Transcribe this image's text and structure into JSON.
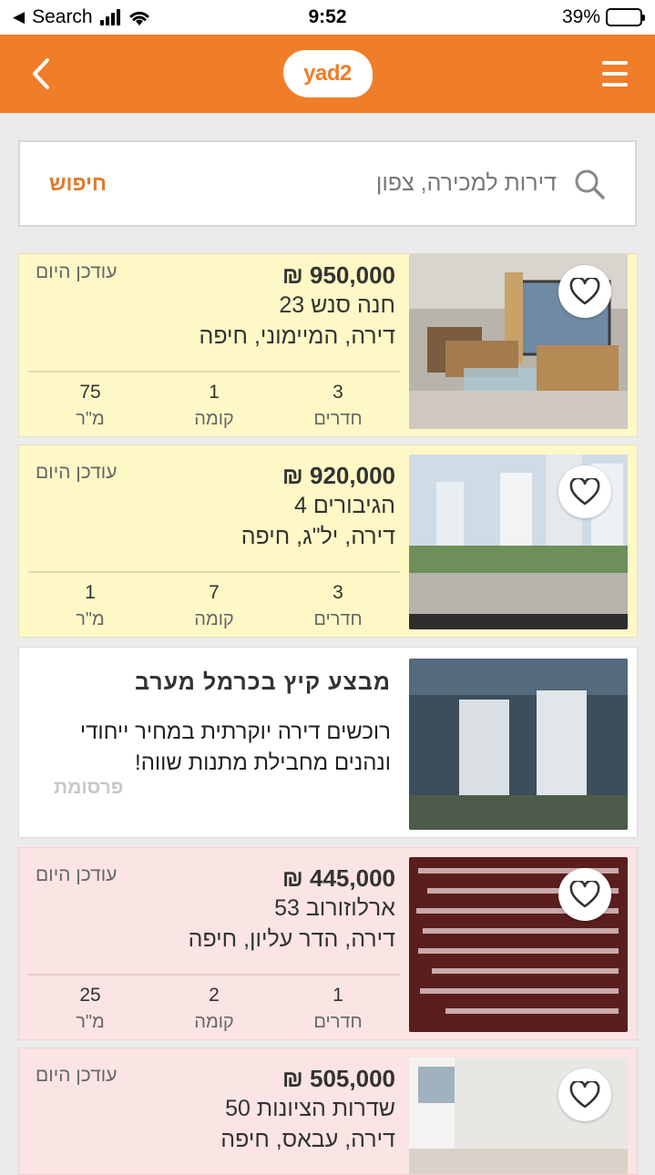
{
  "status_bar": {
    "back_app": "Search",
    "time": "9:52",
    "battery": "39%",
    "battery_level": 0.39
  },
  "header": {
    "logo": "yad2"
  },
  "search": {
    "placeholder": "דירות למכירה, צפון",
    "action": "חיפוש"
  },
  "listings": [
    {
      "price": "950,000 ₪",
      "street": "חנה סנש 23",
      "area": "דירה, המיימוני, חיפה",
      "updated": "עודכן היום",
      "rooms_value": "3",
      "rooms_label": "חדרים",
      "floor_value": "1",
      "floor_label": "קומה",
      "size_value": "75",
      "size_label": "מ\"ר"
    },
    {
      "price": "920,000 ₪",
      "street": "הגיבורים 4",
      "area": "דירה, יל\"ג, חיפה",
      "updated": "עודכן היום",
      "rooms_value": "3",
      "rooms_label": "חדרים",
      "floor_value": "7",
      "floor_label": "קומה",
      "size_value": "1",
      "size_label": "מ\"ר"
    },
    {
      "price": "445,000 ₪",
      "street": "ארלוזורוב 53",
      "area": "דירה, הדר עליון, חיפה",
      "updated": "עודכן היום",
      "rooms_value": "1",
      "rooms_label": "חדרים",
      "floor_value": "2",
      "floor_label": "קומה",
      "size_value": "25",
      "size_label": "מ\"ר"
    },
    {
      "price": "505,000 ₪",
      "street": "שדרות הציונות 50",
      "area": "דירה, עבאס, חיפה",
      "updated": "עודכן היום"
    }
  ],
  "ad": {
    "title": "מבצע קיץ בכרמל מערב",
    "body": "רוכשים דירה יוקרתית במחיר ייחודי ונהנים מחבילת מתנות שווה!",
    "label": "פרסומת"
  },
  "colors": {
    "header": "#f07d28",
    "yellow_card": "#fdf8c6",
    "pink_card": "#fbe4e4"
  }
}
